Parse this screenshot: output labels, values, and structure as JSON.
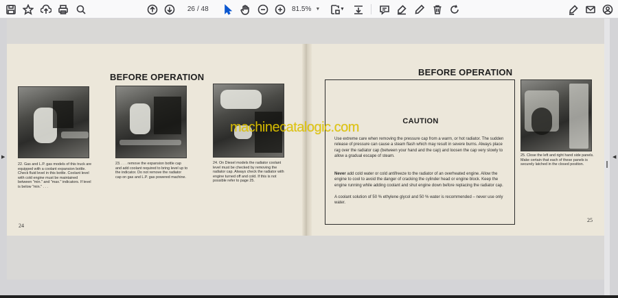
{
  "toolbar": {
    "page_current": "26",
    "page_total": "/ 48",
    "zoom": "81.5%",
    "icons": [
      "save-icon",
      "bookmark-star-icon",
      "upload-icon",
      "print-icon",
      "search-icon",
      "page-up-icon",
      "page-down-icon",
      "select-cursor-icon",
      "hand-icon",
      "zoom-out-icon",
      "zoom-in-icon",
      "fit-page-icon",
      "download-icon",
      "comment-icon",
      "highlight-icon",
      "draw-icon",
      "delete-icon",
      "rotate-icon",
      "sign-icon",
      "email-icon",
      "account-icon"
    ]
  },
  "document": {
    "left_page": {
      "heading": "BEFORE OPERATION",
      "caption_22": "22. Gas and L.P. gas models of this truck are equipped with a coolant expansion bottle. Check fluid level in this bottle. Coolant level with cold engine must be maintained between \"min.\" and \"max.\" indicators. If level is below \"min.\" . . .",
      "caption_23": "23. . . . remove the expansion bottle cap and add coolant required to bring level up to the indicator. Do not remove the radiator cap on gas and L.P. gas powered machine.",
      "caption_24": "24. On Diesel models the radiator coolant level must be checked by removing the radiator cap. Always check the radiator with engine turned off and cold. If this is not possible refer to page 25.",
      "page_number": "24"
    },
    "right_page": {
      "heading": "BEFORE OPERATION",
      "caution_title": "CAUTION",
      "caution_p1": "Use extreme care when removing the pressure cap from a warm, or hot radiator. The sudden release of pressure can cause a steam flash which may result in severe burns. Always place rag over the radiator cap (between your hand and the cap) and loosen the cap very slowly to allow a gradual escape of steam.",
      "caution_p2a": "Never",
      "caution_p2b": " add cold water or cold antifreeze to the radiator of an overheated engine. Allow the engine to cool to avoid the danger of cracking the cylinder head or engine block. Keep the engine running while adding coolant and shut engine down before replacing the radiator cap.",
      "caution_p3": "A coolant solution of 50 % ethylene glycol and 50 % water is recommended – never use only water.",
      "caption_25": "25. Close the left and right hand side panels. Make certain that each of these panels is securely latched in the closed position.",
      "page_number": "25"
    },
    "watermark": "machinecatalogic.com"
  },
  "colors": {
    "toolbar_bg": "#f9f9fa",
    "viewer_bg": "#d4d4d7",
    "paper": "#ece7da",
    "watermark": "#e0c400"
  }
}
